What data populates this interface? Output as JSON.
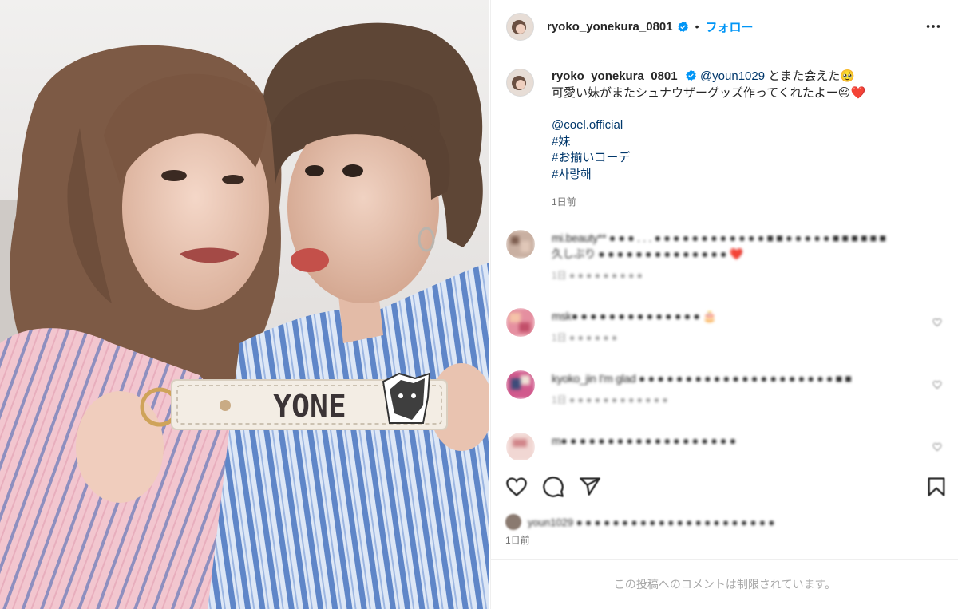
{
  "post": {
    "username": "ryoko_yonekura_0801",
    "follow_label": "フォロー",
    "dot": "•",
    "more_icon": "more-horizontal-icon",
    "verified_color": "#0095f6"
  },
  "caption": {
    "username": "ryoko_yonekura_0801",
    "mention": "@youn1029",
    "line1_text": " とまた会えた🥹",
    "line2_text": "可愛い妹がまたシュナウザーグッズ作ってくれたよー😔❤️",
    "account_link": "@coel.official",
    "hashtags": [
      "#妹",
      "#お揃いコーデ",
      "#사랑해"
    ],
    "time": "1日前"
  },
  "comments": [
    {
      "text": "mi.beauty** ● ● ● . . . ● ● ● ● ● ● ● ● ● ● ● ● ■ ■ ● ● ● ● ● ■ ■ ■ ■ ■ ■",
      "text2": "久しぶり ● ● ● ● ● ● ● ● ● ● ● ● ● ● ❤️",
      "meta": "1日 ● ● ● ● ● ● ●   ● ●"
    },
    {
      "text": "msk● ● ● ● ● ● ● ● ● ● ● ● ● ● 🎂",
      "meta": "1日 ● ● ● ● ● ●"
    },
    {
      "text": "kyoko_jin I'm glad ● ● ● ● ● ● ● ● ● ● ● ● ● ● ● ● ● ● ● ● ● ■ ■",
      "meta": "1日 ● ● ● ● ● ● ● ● ● ● ● ●"
    },
    {
      "text": "m● ● ● ● ● ● ● ● ● ● ● ● ● ● ● ● ● ● ●"
    }
  ],
  "actions": {
    "like_icon": "heart-icon",
    "comment_icon": "comment-icon",
    "share_icon": "share-icon",
    "save_icon": "bookmark-icon"
  },
  "likes": {
    "text": "youn1029 ● ● ● ● ● ● ● ● ● ● ● ● ● ● ● ● ● ● ● ● ● ●"
  },
  "post_time": "1日前",
  "comments_limited": "この投稿へのコメントは制限されています。",
  "photo": {
    "tag_text": "YONE",
    "description_icon": "photo-two-women-holding-keychain"
  }
}
